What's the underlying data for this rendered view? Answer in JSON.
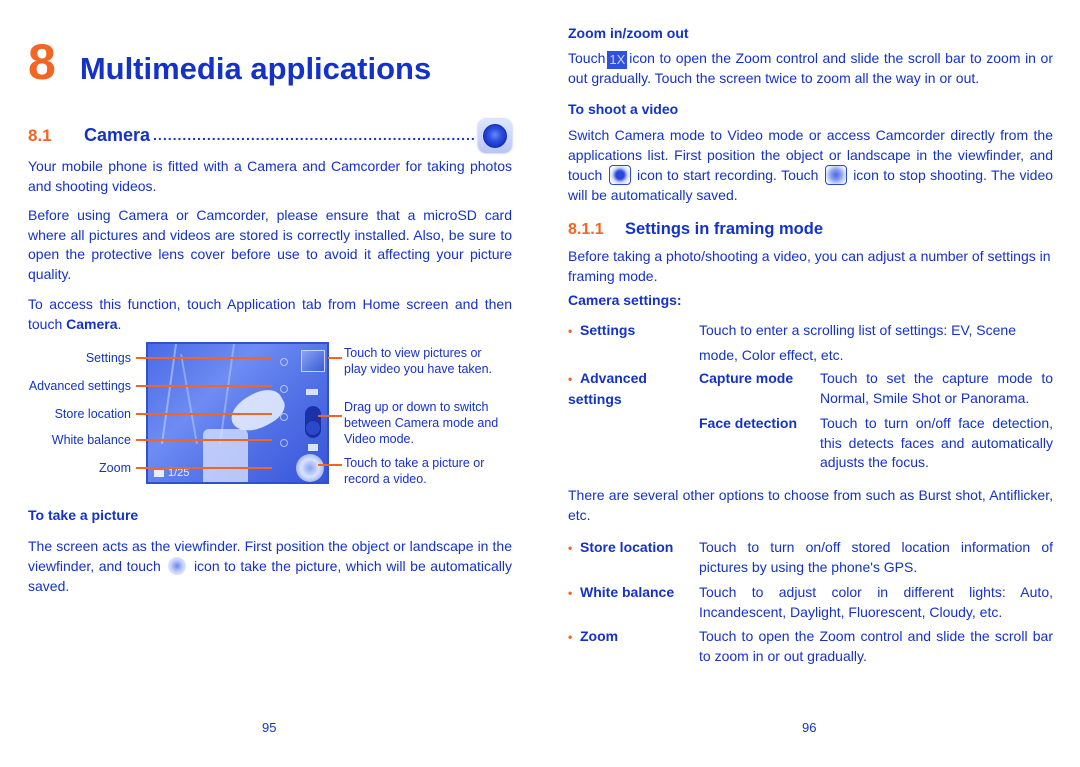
{
  "left_page": {
    "chapter": {
      "number": "8",
      "title": "Multimedia applications"
    },
    "section": {
      "number": "8.1",
      "title": "Camera",
      "dots": "........................................................................",
      "icon": "camera-app-icon"
    },
    "paragraphs": [
      "Your mobile phone is fitted with a Camera and Camcorder for taking photos and shooting videos.",
      "Before using Camera or Camcorder, please ensure that a microSD card where all pictures and videos are stored is correctly installed. Also, be sure to open the protective lens cover before use to avoid it affecting your picture quality.",
      "To access this function, touch Application tab from Home screen and then touch"
    ],
    "access_bold": "Camera",
    "access_end": ".",
    "figure": {
      "labels": [
        "Settings",
        "Advanced settings",
        "Store location",
        "White balance",
        "Zoom"
      ],
      "counter": "1/25",
      "notes": [
        {
          "line1": "Touch to view pictures or",
          "line2": "play video you have taken."
        },
        {
          "line1": "Drag up or down to switch",
          "line2": "between Camera mode and",
          "line3": "Video mode."
        },
        {
          "line1": "Touch to take a picture or",
          "line2": "record a video."
        }
      ]
    },
    "take_picture": {
      "heading": "To take a picture",
      "text_before": "The screen acts as the viewfinder. First position the object or landscape in the viewfinder, and touch",
      "icon": "shutter-icon",
      "text_after": "icon to take the picture, which will be automatically saved."
    },
    "page_number": "95"
  },
  "right_page": {
    "zoom": {
      "heading": "Zoom in/zoom out",
      "text_before": "Touch",
      "icon_label": "1X",
      "text_after": "icon to open the Zoom control and slide the scroll bar to zoom in or out gradually. Touch the screen twice to zoom all the way in or out."
    },
    "video": {
      "heading": "To shoot a video",
      "text1": "Switch Camera mode to Video mode or access Camcorder directly from the applications list. First position the object or landscape in the viewfinder, and touch",
      "icon1": "record-icon",
      "text2": "icon to start recording. Touch",
      "icon2": "stop-icon",
      "text3": "icon to stop shooting. The video will be automatically saved."
    },
    "subsection": {
      "number": "8.1.1",
      "title": "Settings in framing mode"
    },
    "intro": "Before taking a photo/shooting a video, you can adjust a number of settings in framing mode.",
    "camera_settings_heading": "Camera settings:",
    "settings": [
      {
        "term": "Settings",
        "desc": "Touch to enter a scrolling list of settings: EV, Scene mode, Color effect, etc."
      },
      {
        "term": "Advanced settings",
        "sub": [
          {
            "term": "Capture mode",
            "desc": "Touch to set the capture mode to Normal, Smile Shot or Panorama."
          },
          {
            "term": "Face detection",
            "desc": "Touch to turn on/off face detection, this detects faces and automatically adjusts the focus."
          }
        ]
      },
      {
        "term": "Store location",
        "desc": "Touch to turn on/off stored location information of pictures by using the phone's GPS."
      },
      {
        "term": "White balance",
        "desc": "Touch to adjust color in different lights: Auto, Incandescent, Daylight, Fluorescent, Cloudy, etc."
      },
      {
        "term": "Zoom",
        "desc": "Touch to open the Zoom control and slide the scroll bar to zoom in or out gradually."
      }
    ],
    "other_options": "There are several other options to choose from such as Burst shot, Antiflicker, etc.",
    "bullet": "•",
    "page_number": "96"
  },
  "colors": {
    "text": "#1432c8",
    "accent": "#f26522"
  }
}
